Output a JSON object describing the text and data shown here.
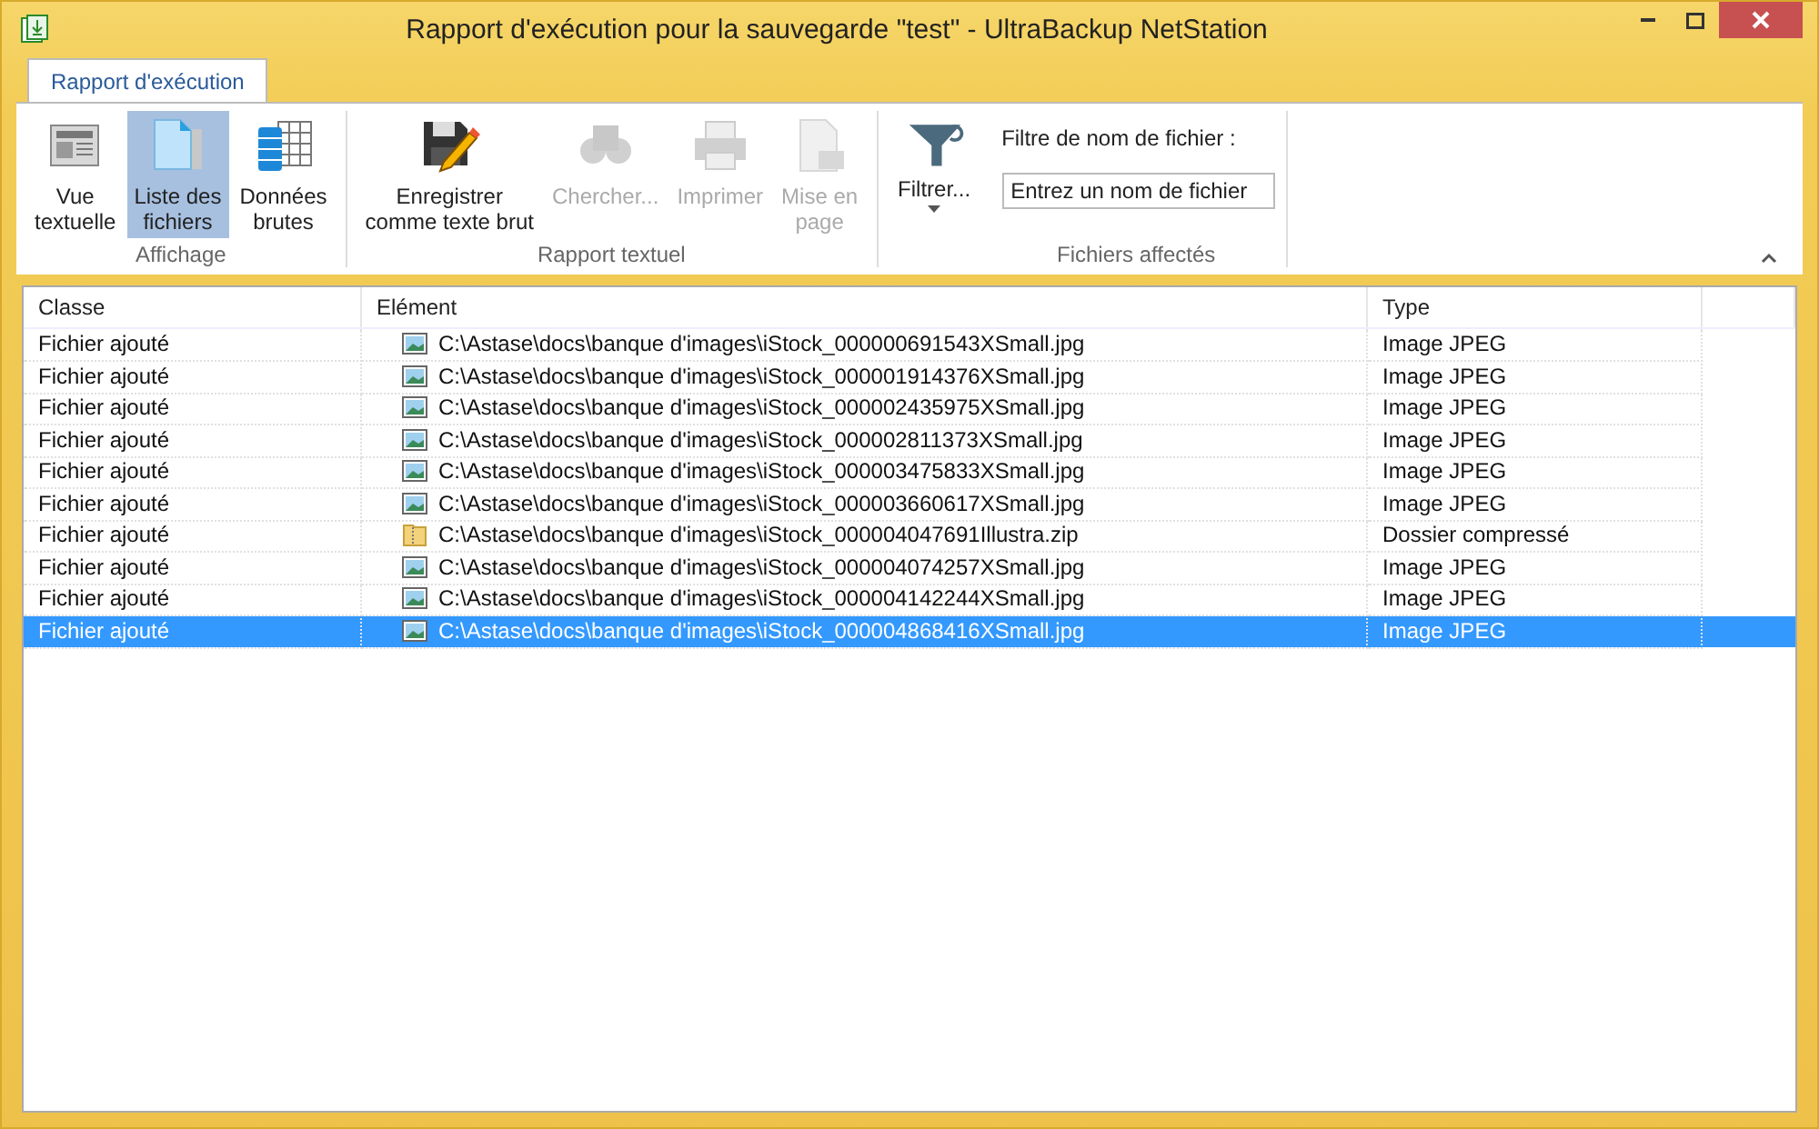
{
  "window": {
    "title": "Rapport d'exécution pour la sauvegarde \"test\" - UltraBackup NetStation"
  },
  "tabs": [
    {
      "label": "Rapport d'exécution",
      "selected": true
    }
  ],
  "ribbon": {
    "groups": [
      {
        "label": "Affichage",
        "buttons": [
          {
            "label": "Vue\ntextuelle",
            "selected": false,
            "disabled": false
          },
          {
            "label": "Liste des\nfichiers",
            "selected": true,
            "disabled": false
          },
          {
            "label": "Données\nbrutes",
            "selected": false,
            "disabled": false
          }
        ]
      },
      {
        "label": "Rapport textuel",
        "buttons": [
          {
            "label": "Enregistrer\ncomme texte brut",
            "selected": false,
            "disabled": false
          },
          {
            "label": "Chercher...",
            "selected": false,
            "disabled": true
          },
          {
            "label": "Imprimer",
            "selected": false,
            "disabled": true
          },
          {
            "label": "Mise en\npage",
            "selected": false,
            "disabled": true
          }
        ]
      },
      {
        "label": "Fichiers affectés",
        "buttons": [
          {
            "label": "Filtrer...",
            "selected": false,
            "disabled": false
          }
        ],
        "filter": {
          "label": "Filtre de nom de fichier :",
          "value": "Entrez un nom de fichier"
        }
      }
    ]
  },
  "table": {
    "columns": [
      "Classe",
      "Elément",
      "Type"
    ],
    "rows": [
      {
        "class": "Fichier ajouté",
        "element": "C:\\Astase\\docs\\banque d'images\\iStock_000000691543XSmall.jpg",
        "type": "Image JPEG",
        "kind": "image",
        "selected": false
      },
      {
        "class": "Fichier ajouté",
        "element": "C:\\Astase\\docs\\banque d'images\\iStock_000001914376XSmall.jpg",
        "type": "Image JPEG",
        "kind": "image",
        "selected": false
      },
      {
        "class": "Fichier ajouté",
        "element": "C:\\Astase\\docs\\banque d'images\\iStock_000002435975XSmall.jpg",
        "type": "Image JPEG",
        "kind": "image",
        "selected": false
      },
      {
        "class": "Fichier ajouté",
        "element": "C:\\Astase\\docs\\banque d'images\\iStock_000002811373XSmall.jpg",
        "type": "Image JPEG",
        "kind": "image",
        "selected": false
      },
      {
        "class": "Fichier ajouté",
        "element": "C:\\Astase\\docs\\banque d'images\\iStock_000003475833XSmall.jpg",
        "type": "Image JPEG",
        "kind": "image",
        "selected": false
      },
      {
        "class": "Fichier ajouté",
        "element": "C:\\Astase\\docs\\banque d'images\\iStock_000003660617XSmall.jpg",
        "type": "Image JPEG",
        "kind": "image",
        "selected": false
      },
      {
        "class": "Fichier ajouté",
        "element": "C:\\Astase\\docs\\banque d'images\\iStock_000004047691Illustra.zip",
        "type": "Dossier compressé",
        "kind": "archive",
        "selected": false
      },
      {
        "class": "Fichier ajouté",
        "element": "C:\\Astase\\docs\\banque d'images\\iStock_000004074257XSmall.jpg",
        "type": "Image JPEG",
        "kind": "image",
        "selected": false
      },
      {
        "class": "Fichier ajouté",
        "element": "C:\\Astase\\docs\\banque d'images\\iStock_000004142244XSmall.jpg",
        "type": "Image JPEG",
        "kind": "image",
        "selected": false
      },
      {
        "class": "Fichier ajouté",
        "element": "C:\\Astase\\docs\\banque d'images\\iStock_000004868416XSmall.jpg",
        "type": "Image JPEG",
        "kind": "image",
        "selected": true
      }
    ]
  }
}
